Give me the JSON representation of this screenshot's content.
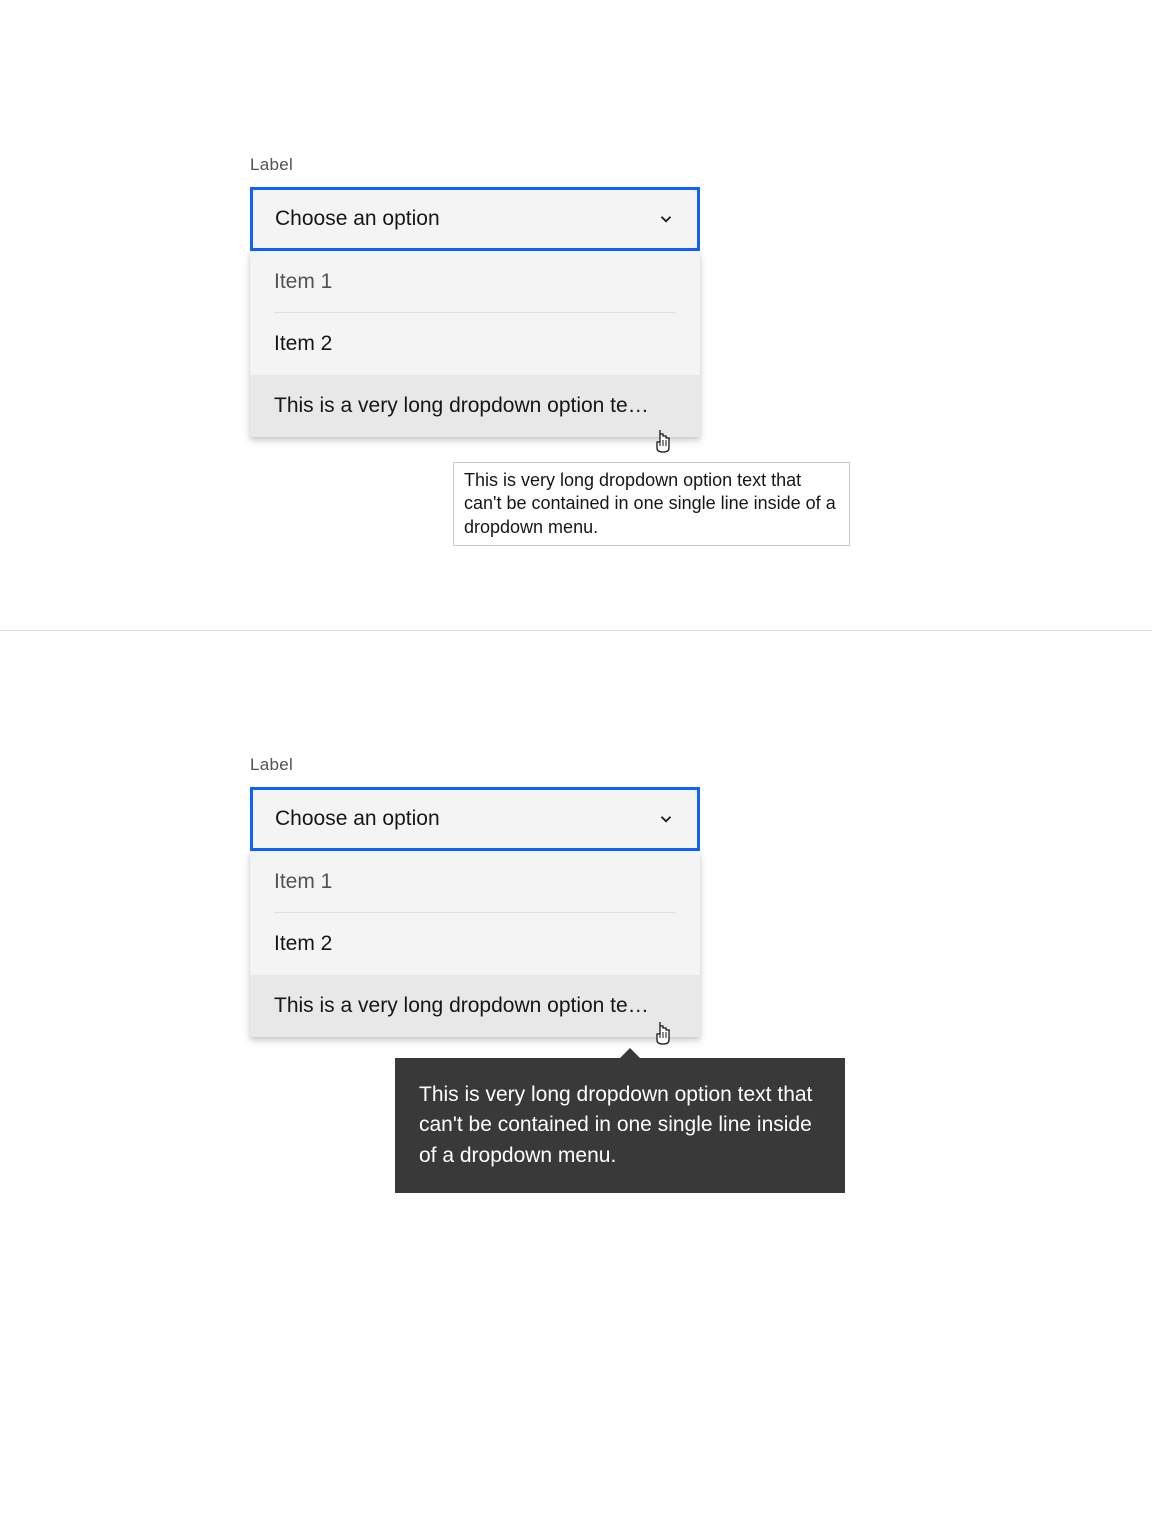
{
  "example1": {
    "label": "Label",
    "trigger_text": "Choose an option",
    "items": [
      "Item 1",
      "Item 2",
      "This is a very long dropdown option te…"
    ],
    "tooltip": "This is very long dropdown option text that can't be contained in one single line inside of a dropdown menu."
  },
  "example2": {
    "label": "Label",
    "trigger_text": "Choose an option",
    "items": [
      "Item 1",
      "Item 2",
      "This is a very long dropdown option te…"
    ],
    "tooltip": "This is very long dropdown option text that can't be contained in one single line inside of a dropdown menu."
  }
}
